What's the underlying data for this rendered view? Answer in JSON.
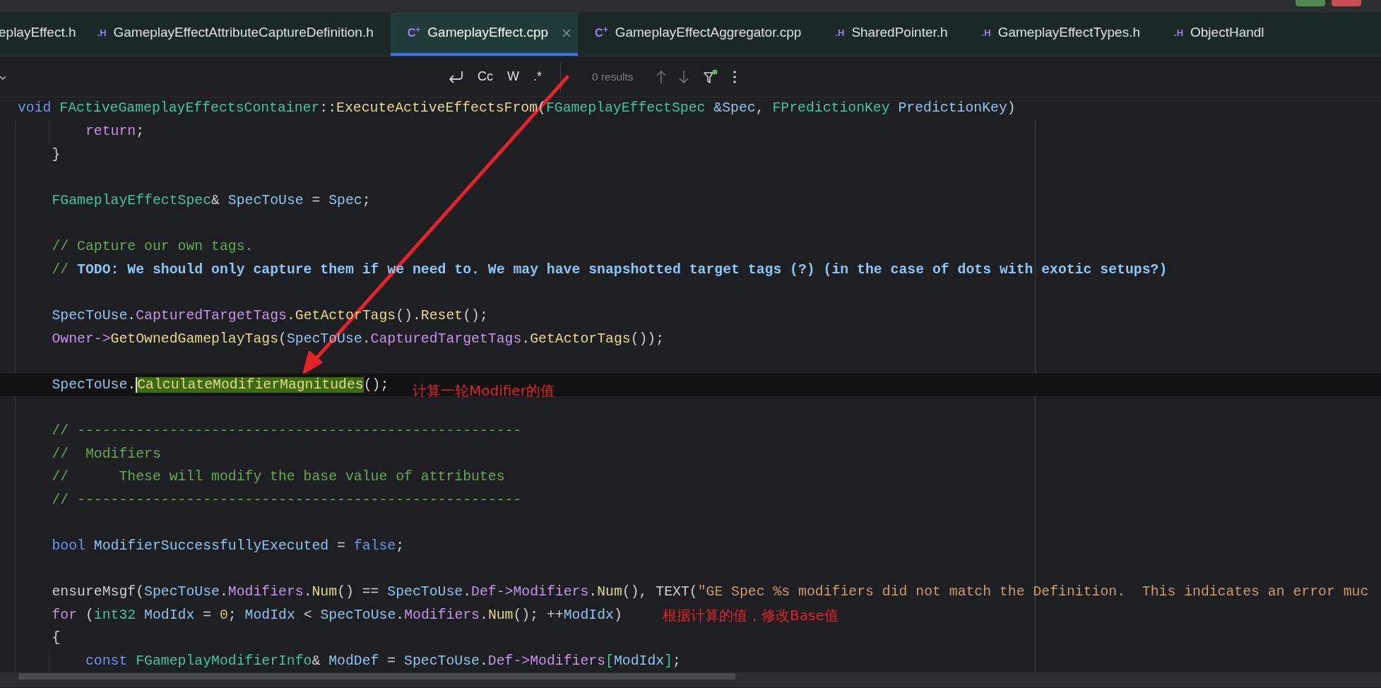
{
  "tabs": [
    {
      "kind": "cut",
      "label": "eplayEffect.h",
      "selected": false
    },
    {
      "kind": "header",
      "icon": ".H",
      "label": "GameplayEffectAttributeCaptureDefinition.h",
      "selected": false
    },
    {
      "kind": "cpp",
      "icon": "C$^{+}$",
      "label": "GameplayEffect.cpp",
      "selected": true
    },
    {
      "kind": "cpp",
      "icon": "C$^{+}$",
      "label": "GameplayEffectAggregator.cpp",
      "selected": false
    },
    {
      "kind": "header",
      "icon": ".H",
      "label": "SharedPointer.h",
      "selected": false
    },
    {
      "kind": "header",
      "icon": ".H",
      "label": "GameplayEffectTypes.h",
      "selected": false
    },
    {
      "kind": "header",
      "icon": ".H",
      "label": "ObjectHandl",
      "selected": false
    }
  ],
  "find_toolbar": {
    "toggles": [
      "Cc",
      "W",
      ".*"
    ],
    "results": "0 results"
  },
  "sticky_header": {
    "tokens": [
      {
        "text": "void",
        "kind": "keyword"
      },
      {
        "text": " FActiveGameplayEffectsContainer",
        "kind": "type"
      },
      {
        "text": "::",
        "kind": "plain"
      },
      {
        "text": "ExecuteActiveEffectsFrom",
        "kind": "method"
      },
      {
        "text": "(",
        "kind": "plain"
      },
      {
        "text": "FGameplayEffectSpec",
        "kind": "type"
      },
      {
        "text": " &Spec",
        "kind": "local"
      },
      {
        "text": ", ",
        "kind": "plain"
      },
      {
        "text": "FPredictionKey",
        "kind": "type"
      },
      {
        "text": " PredictionKey",
        "kind": "local"
      },
      {
        "text": ")",
        "kind": "plain"
      }
    ]
  },
  "code": {
    "lines": [
      {
        "kind": "code",
        "current": false,
        "tokens": [
          {
            "text": "        return",
            "kind": "control"
          },
          {
            "text": ";",
            "kind": "plain"
          }
        ]
      },
      {
        "kind": "code",
        "current": false,
        "tokens": [
          {
            "text": "    }",
            "kind": "plain"
          }
        ]
      },
      {
        "kind": "blank",
        "current": false
      },
      {
        "kind": "code",
        "current": false,
        "tokens": [
          {
            "text": "    FGameplayEffectSpec",
            "kind": "type"
          },
          {
            "text": "& ",
            "kind": "plain"
          },
          {
            "text": "SpecToUse",
            "kind": "local"
          },
          {
            "text": " = ",
            "kind": "plain"
          },
          {
            "text": "Spec",
            "kind": "local"
          },
          {
            "text": ";",
            "kind": "plain"
          }
        ]
      },
      {
        "kind": "blank",
        "current": false
      },
      {
        "kind": "code",
        "current": false,
        "tokens": [
          {
            "text": "    // Capture our own tags.",
            "kind": "comment"
          }
        ]
      },
      {
        "kind": "code",
        "current": false,
        "tokens": [
          {
            "text": "    // ",
            "kind": "comment"
          },
          {
            "text": "TODO: We should only capture them if we need to. We may have snapshotted target tags (?) (in the case of dots with exotic setups?)",
            "kind": "todo"
          }
        ]
      },
      {
        "kind": "blank",
        "current": false
      },
      {
        "kind": "code",
        "current": false,
        "tokens": [
          {
            "text": "    SpecToUse",
            "kind": "local"
          },
          {
            "text": ".",
            "kind": "plain"
          },
          {
            "text": "CapturedTargetTags",
            "kind": "field"
          },
          {
            "text": ".",
            "kind": "plain"
          },
          {
            "text": "GetActorTags",
            "kind": "method"
          },
          {
            "text": "().",
            "kind": "plain"
          },
          {
            "text": "Reset",
            "kind": "method"
          },
          {
            "text": "();",
            "kind": "plain"
          }
        ]
      },
      {
        "kind": "code",
        "current": false,
        "tokens": [
          {
            "text": "    Owner",
            "kind": "field"
          },
          {
            "text": "->",
            "kind": "field"
          },
          {
            "text": "GetOwnedGameplayTags",
            "kind": "method"
          },
          {
            "text": "(",
            "kind": "plain"
          },
          {
            "text": "SpecToUse",
            "kind": "local"
          },
          {
            "text": ".",
            "kind": "plain"
          },
          {
            "text": "CapturedTargetTags",
            "kind": "field"
          },
          {
            "text": ".",
            "kind": "plain"
          },
          {
            "text": "GetActorTags",
            "kind": "method"
          },
          {
            "text": "());",
            "kind": "plain"
          }
        ]
      },
      {
        "kind": "blank",
        "current": false
      },
      {
        "kind": "code",
        "current": true,
        "tokens": [
          {
            "text": "    SpecToUse",
            "kind": "local"
          },
          {
            "text": ".",
            "kind": "plain"
          },
          {
            "text": "CalculateModifierMagnitudes",
            "kind": "match"
          },
          {
            "text": "();",
            "kind": "plain"
          }
        ]
      },
      {
        "kind": "blank",
        "current": false
      },
      {
        "kind": "code",
        "current": false,
        "tokens": [
          {
            "text": "    // -----------------------------------------------------",
            "kind": "comment"
          }
        ]
      },
      {
        "kind": "code",
        "current": false,
        "tokens": [
          {
            "text": "    //  Modifiers",
            "kind": "comment"
          }
        ]
      },
      {
        "kind": "code",
        "current": false,
        "tokens": [
          {
            "text": "    //      These will modify the base value of attributes",
            "kind": "comment"
          }
        ]
      },
      {
        "kind": "code",
        "current": false,
        "tokens": [
          {
            "text": "    // -----------------------------------------------------",
            "kind": "comment"
          }
        ]
      },
      {
        "kind": "blank",
        "current": false
      },
      {
        "kind": "code",
        "current": false,
        "tokens": [
          {
            "text": "    bool",
            "kind": "keyword"
          },
          {
            "text": " ModifierSuccessfullyExecuted",
            "kind": "local"
          },
          {
            "text": " = ",
            "kind": "plain"
          },
          {
            "text": "false",
            "kind": "keyword"
          },
          {
            "text": ";",
            "kind": "plain"
          }
        ]
      },
      {
        "kind": "blank",
        "current": false
      },
      {
        "kind": "code",
        "current": false,
        "tokens": [
          {
            "text": "    ensureMsgf(",
            "kind": "plain"
          },
          {
            "text": "SpecToUse",
            "kind": "local"
          },
          {
            "text": ".",
            "kind": "plain"
          },
          {
            "text": "Modifiers",
            "kind": "field"
          },
          {
            "text": ".",
            "kind": "plain"
          },
          {
            "text": "Num",
            "kind": "method"
          },
          {
            "text": "() == ",
            "kind": "plain"
          },
          {
            "text": "SpecToUse",
            "kind": "local"
          },
          {
            "text": ".",
            "kind": "plain"
          },
          {
            "text": "Def",
            "kind": "field"
          },
          {
            "text": "->",
            "kind": "field"
          },
          {
            "text": "Modifiers",
            "kind": "field"
          },
          {
            "text": ".",
            "kind": "plain"
          },
          {
            "text": "Num",
            "kind": "method"
          },
          {
            "text": "(), TEXT(",
            "kind": "plain"
          },
          {
            "text": "\"GE Spec %s modifiers did not match the Definition.  This indicates an error muc",
            "kind": "string"
          }
        ]
      },
      {
        "kind": "code",
        "current": false,
        "tokens": [
          {
            "text": "    for",
            "kind": "control"
          },
          {
            "text": " (",
            "kind": "plain"
          },
          {
            "text": "int32",
            "kind": "type"
          },
          {
            "text": " ModIdx",
            "kind": "local"
          },
          {
            "text": " = ",
            "kind": "plain"
          },
          {
            "text": "0",
            "kind": "number"
          },
          {
            "text": "; ",
            "kind": "plain"
          },
          {
            "text": "ModIdx",
            "kind": "local"
          },
          {
            "text": " < ",
            "kind": "plain"
          },
          {
            "text": "SpecToUse",
            "kind": "local"
          },
          {
            "text": ".",
            "kind": "plain"
          },
          {
            "text": "Modifiers",
            "kind": "field"
          },
          {
            "text": ".",
            "kind": "plain"
          },
          {
            "text": "Num",
            "kind": "method"
          },
          {
            "text": "(); ++",
            "kind": "plain"
          },
          {
            "text": "ModIdx",
            "kind": "local"
          },
          {
            "text": ")",
            "kind": "plain"
          }
        ]
      },
      {
        "kind": "code",
        "current": false,
        "tokens": [
          {
            "text": "    {",
            "kind": "plain"
          }
        ]
      },
      {
        "kind": "code",
        "current": false,
        "tokens": [
          {
            "text": "        const",
            "kind": "keyword"
          },
          {
            "text": " FGameplayModifierInfo",
            "kind": "type"
          },
          {
            "text": "& ",
            "kind": "plain"
          },
          {
            "text": "ModDef",
            "kind": "local"
          },
          {
            "text": " = ",
            "kind": "plain"
          },
          {
            "text": "SpecToUse",
            "kind": "local"
          },
          {
            "text": ".",
            "kind": "plain"
          },
          {
            "text": "Def",
            "kind": "field"
          },
          {
            "text": "->",
            "kind": "field"
          },
          {
            "text": "Modifiers",
            "kind": "field"
          },
          {
            "text": "[",
            "kind": "type"
          },
          {
            "text": "ModIdx",
            "kind": "local"
          },
          {
            "text": "]",
            "kind": "type"
          },
          {
            "text": ";",
            "kind": "plain"
          }
        ]
      }
    ]
  },
  "annotations": [
    {
      "text": "计算一轮Modifier的值"
    },
    {
      "text": "根据计算的值，修改Base值"
    }
  ]
}
